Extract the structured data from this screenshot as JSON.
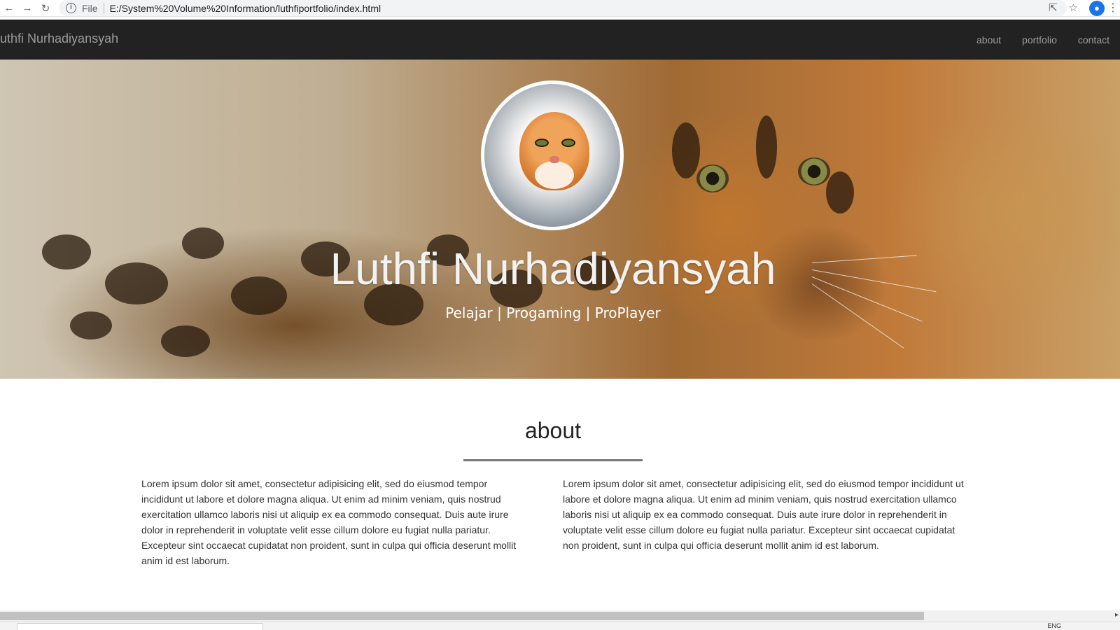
{
  "browser": {
    "file_label": "File",
    "url": "E:/System%20Volume%20Information/luthfiportfolio/index.html",
    "tray_text": "ENG"
  },
  "navbar": {
    "brand": "uthfi Nurhadiyansyah",
    "links": [
      "about",
      "portfolio",
      "contact"
    ]
  },
  "hero": {
    "title": "Luthfi Nurhadiyansyah",
    "subtitle": "Pelajar | Progaming | ProPlayer"
  },
  "about": {
    "title": "about",
    "left_text": "Lorem ipsum dolor sit amet, consectetur adipisicing elit, sed do eiusmod tempor incididunt ut labore et dolore magna aliqua. Ut enim ad minim veniam, quis nostrud exercitation ullamco laboris nisi ut aliquip ex ea commodo consequat. Duis aute irure dolor in reprehenderit in voluptate velit esse cillum dolore eu fugiat nulla pariatur. Excepteur sint occaecat cupidatat non proident, sunt in culpa qui officia deserunt mollit anim id est laborum.",
    "right_text": "Lorem ipsum dolor sit amet, consectetur adipisicing elit, sed do eiusmod tempor incididunt ut labore et dolore magna aliqua. Ut enim ad minim veniam, quis nostrud exercitation ullamco laboris nisi ut aliquip ex ea commodo consequat. Duis aute irure dolor in reprehenderit in voluptate velit esse cillum dolore eu fugiat nulla pariatur. Excepteur sint occaecat cupidatat non proident, sunt in culpa qui officia deserunt mollit anim id est laborum."
  },
  "colors": {
    "navbar_bg": "#222222",
    "nav_text": "#9d9d9d",
    "hero_text": "#f2f2f2"
  }
}
